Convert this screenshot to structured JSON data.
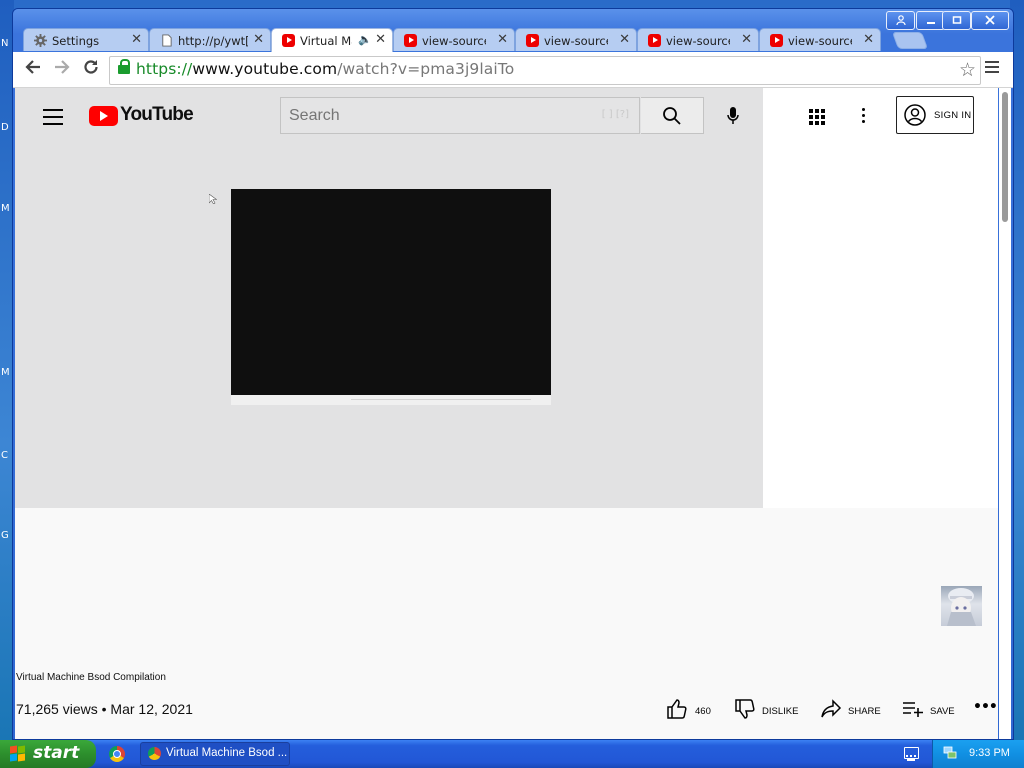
{
  "desktop": {
    "side_letters": [
      "N",
      "D",
      "M",
      "M",
      "C",
      "G"
    ]
  },
  "browser": {
    "tabs": [
      {
        "label": "Settings",
        "icon": "gear-icon"
      },
      {
        "label": "http://p/ywt[[",
        "icon": "page-icon"
      },
      {
        "label": "Virtual Mac",
        "icon": "youtube-icon",
        "audio": true
      },
      {
        "label": "view-source:h",
        "icon": "youtube-icon"
      },
      {
        "label": "view-source:h",
        "icon": "youtube-icon"
      },
      {
        "label": "view-source:h",
        "icon": "youtube-icon"
      },
      {
        "label": "view-source:h",
        "icon": "youtube-icon"
      }
    ],
    "address": {
      "scheme": "https://",
      "host": "www.youtube.com",
      "path": "/watch?v=pma3j9laiTo"
    }
  },
  "youtube": {
    "logo_text": "YouTube",
    "search_placeholder": "Search",
    "search_shortcut": "[ ] [?]",
    "sign_in_label": "SIGN IN",
    "video": {
      "title": "Virtual Machine Bsod Compilation",
      "views": "71,265 views",
      "date": "Mar 12, 2021",
      "likes": "460",
      "dislike_label": "DISLIKE",
      "share_label": "SHARE",
      "save_label": "SAVE",
      "more_label": "•••"
    }
  },
  "taskbar": {
    "start_label": "start",
    "window_button": "Virtual Machine Bsod ...",
    "clock": "9:33 PM"
  },
  "colors": {
    "youtube_red": "#ff0000",
    "xp_blue": "#245edc",
    "start_green": "#2d8f2d",
    "url_green": "#178a28"
  }
}
